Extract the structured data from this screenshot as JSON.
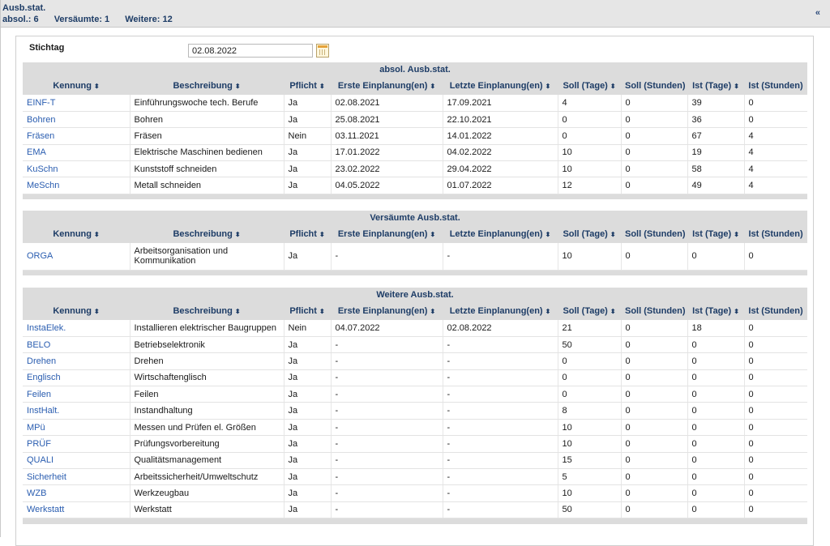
{
  "header": {
    "title": "Ausb.stat.",
    "absol": "absol.: 6",
    "versaeumt": "Versäumte: 1",
    "weitere": "Weitere: 12",
    "collapse": "«"
  },
  "stichtag": {
    "label": "Stichtag",
    "value": "02.08.2022"
  },
  "columns": [
    "Kennung",
    "Beschreibung",
    "Pflicht",
    "Erste Einplanung(en)",
    "Letzte Einplanung(en)",
    "Soll (Tage)",
    "Soll (Stunden)",
    "Ist (Tage)",
    "Ist (Stunden)"
  ],
  "sort_arrow": "⬍",
  "tables": [
    {
      "caption": "absol. Ausb.stat.",
      "rows": [
        [
          "EINF-T",
          "Einführungswoche tech. Berufe",
          "Ja",
          "02.08.2021",
          "17.09.2021",
          "4",
          "0",
          "39",
          "0"
        ],
        [
          "Bohren",
          "Bohren",
          "Ja",
          "25.08.2021",
          "22.10.2021",
          "0",
          "0",
          "36",
          "0"
        ],
        [
          "Fräsen",
          "Fräsen",
          "Nein",
          "03.11.2021",
          "14.01.2022",
          "0",
          "0",
          "67",
          "4"
        ],
        [
          "EMA",
          "Elektrische Maschinen bedienen",
          "Ja",
          "17.01.2022",
          "04.02.2022",
          "10",
          "0",
          "19",
          "4"
        ],
        [
          "KuSchn",
          "Kunststoff schneiden",
          "Ja",
          "23.02.2022",
          "29.04.2022",
          "10",
          "0",
          "58",
          "4"
        ],
        [
          "MeSchn",
          "Metall schneiden",
          "Ja",
          "04.05.2022",
          "01.07.2022",
          "12",
          "0",
          "49",
          "4"
        ]
      ]
    },
    {
      "caption": "Versäumte Ausb.stat.",
      "rows": [
        [
          "ORGA",
          "Arbeitsorganisation und Kommunikation",
          "Ja",
          "-",
          "-",
          "10",
          "0",
          "0",
          "0"
        ]
      ]
    },
    {
      "caption": "Weitere Ausb.stat.",
      "rows": [
        [
          "InstaElek.",
          "Installieren elektrischer Baugruppen",
          "Nein",
          "04.07.2022",
          "02.08.2022",
          "21",
          "0",
          "18",
          "0"
        ],
        [
          "BELO",
          "Betriebselektronik",
          "Ja",
          "-",
          "-",
          "50",
          "0",
          "0",
          "0"
        ],
        [
          "Drehen",
          "Drehen",
          "Ja",
          "-",
          "-",
          "0",
          "0",
          "0",
          "0"
        ],
        [
          "Englisch",
          "Wirtschaftenglisch",
          "Ja",
          "-",
          "-",
          "0",
          "0",
          "0",
          "0"
        ],
        [
          "Feilen",
          "Feilen",
          "Ja",
          "-",
          "-",
          "0",
          "0",
          "0",
          "0"
        ],
        [
          "InstHalt.",
          "Instandhaltung",
          "Ja",
          "-",
          "-",
          "8",
          "0",
          "0",
          "0"
        ],
        [
          "MPü",
          "Messen und Prüfen el. Größen",
          "Ja",
          "-",
          "-",
          "10",
          "0",
          "0",
          "0"
        ],
        [
          "PRÜF",
          "Prüfungsvorbereitung",
          "Ja",
          "-",
          "-",
          "10",
          "0",
          "0",
          "0"
        ],
        [
          "QUALI",
          "Qualitätsmanagement",
          "Ja",
          "-",
          "-",
          "15",
          "0",
          "0",
          "0"
        ],
        [
          "Sicherheit",
          "Arbeitssicherheit/Umweltschutz",
          "Ja",
          "-",
          "-",
          "5",
          "0",
          "0",
          "0"
        ],
        [
          "WZB",
          "Werkzeugbau",
          "Ja",
          "-",
          "-",
          "10",
          "0",
          "0",
          "0"
        ],
        [
          "Werkstatt",
          "Werkstatt",
          "Ja",
          "-",
          "-",
          "50",
          "0",
          "0",
          "0"
        ]
      ]
    }
  ]
}
